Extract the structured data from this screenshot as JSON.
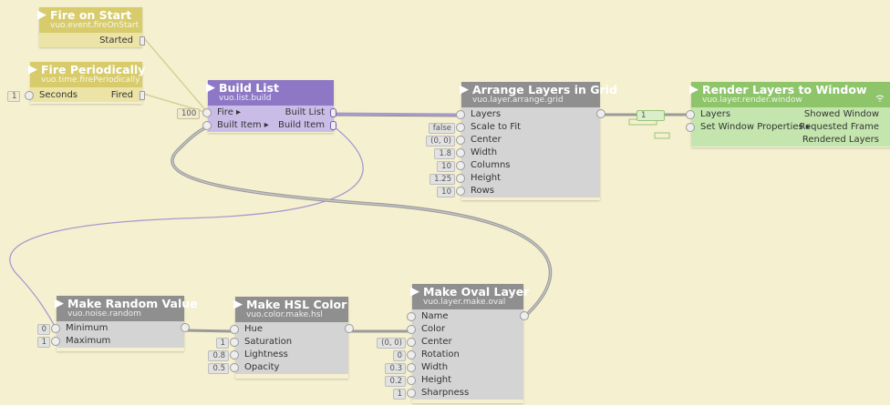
{
  "nodes": {
    "fire_on_start": {
      "title": "Fire on Start",
      "class": "vuo.event.fireOnStart",
      "outputs": [
        "Started"
      ]
    },
    "fire_periodically": {
      "title": "Fire Periodically",
      "class": "vuo.time.firePeriodically",
      "input_label": "Seconds",
      "input_value": "1",
      "output_label": "Fired"
    },
    "build_list": {
      "title": "Build List",
      "class": "vuo.list.build",
      "inputs": [
        "Fire ▸",
        "Built Item ▸"
      ],
      "outputs": [
        "Built List",
        "Build Item"
      ],
      "fire_value": "100"
    },
    "arrange_layers": {
      "title": "Arrange Layers in Grid",
      "class": "vuo.layer.arrange.grid",
      "inputs": [
        "Layers",
        "Scale to Fit",
        "Center",
        "Width",
        "Columns",
        "Height",
        "Rows"
      ],
      "values": [
        "",
        "false",
        "(0, 0)",
        "1.8",
        "10",
        "1.25",
        "10"
      ]
    },
    "render_layers": {
      "title": "Render Layers to Window",
      "class": "vuo.layer.render.window",
      "inputs": [
        "Layers",
        "Set Window Properties ▸"
      ],
      "outputs": [
        "Showed Window",
        "Requested Frame",
        "Rendered Layers"
      ],
      "layers_value": "1"
    },
    "make_random": {
      "title": "Make Random Value",
      "class": "vuo.noise.random",
      "inputs": [
        "Minimum",
        "Maximum"
      ],
      "values": [
        "0",
        "1"
      ]
    },
    "make_hsl": {
      "title": "Make HSL Color",
      "class": "vuo.color.make.hsl",
      "inputs": [
        "Hue",
        "Saturation",
        "Lightness",
        "Opacity"
      ],
      "values": [
        "",
        "1",
        "0.8",
        "0.5"
      ]
    },
    "make_oval": {
      "title": "Make Oval Layer",
      "class": "vuo.layer.make.oval",
      "inputs": [
        "Name",
        "Color",
        "Center",
        "Rotation",
        "Width",
        "Height",
        "Sharpness"
      ],
      "values": [
        "",
        "",
        "(0, 0)",
        "0",
        "0.3",
        "0.2",
        "1"
      ]
    }
  },
  "colors": {
    "canvas": "#f5f0cf",
    "event": "#d7cb6c",
    "list": "#8e78c6",
    "layer": "#8f8f8f",
    "render": "#8ec56a"
  },
  "icons": {
    "node_arrow": "triangle-right-icon",
    "port": "circle-port-icon",
    "wifi": "wifi-icon"
  }
}
